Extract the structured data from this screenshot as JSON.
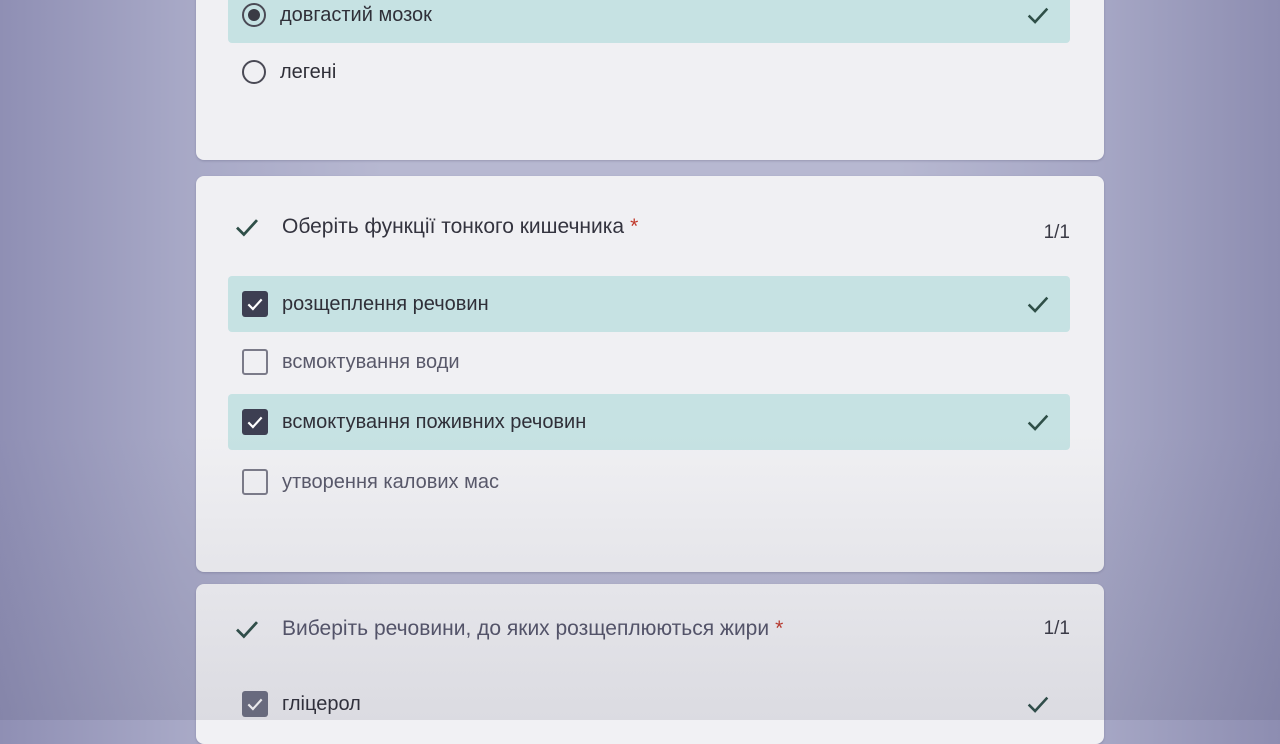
{
  "q1": {
    "options": [
      {
        "label": "довгастий мозок",
        "selected": true,
        "correct": true
      },
      {
        "label": "легені",
        "selected": false,
        "correct": false
      }
    ]
  },
  "q2": {
    "title": "Оберіть функції  тонкого кишечника",
    "required_mark": "*",
    "score": "1/1",
    "options": [
      {
        "label": "розщеплення речовин",
        "checked": true,
        "correct": true
      },
      {
        "label": "всмоктування води",
        "checked": false,
        "correct": false
      },
      {
        "label": "всмоктування поживних речовин",
        "checked": true,
        "correct": true
      },
      {
        "label": "утворення калових мас",
        "checked": false,
        "correct": false
      }
    ]
  },
  "q3": {
    "title": "Виберіть речовини, до яких розщеплюються жири",
    "required_mark": "*",
    "score": "1/1",
    "options": [
      {
        "label": "гліцерол",
        "checked": true,
        "correct": true
      }
    ]
  },
  "colors": {
    "correct_highlight": "#c6e2e3",
    "checkbox_fill": "#3d3f52",
    "required_star": "#c0392b",
    "tick": "#2f4f48"
  }
}
